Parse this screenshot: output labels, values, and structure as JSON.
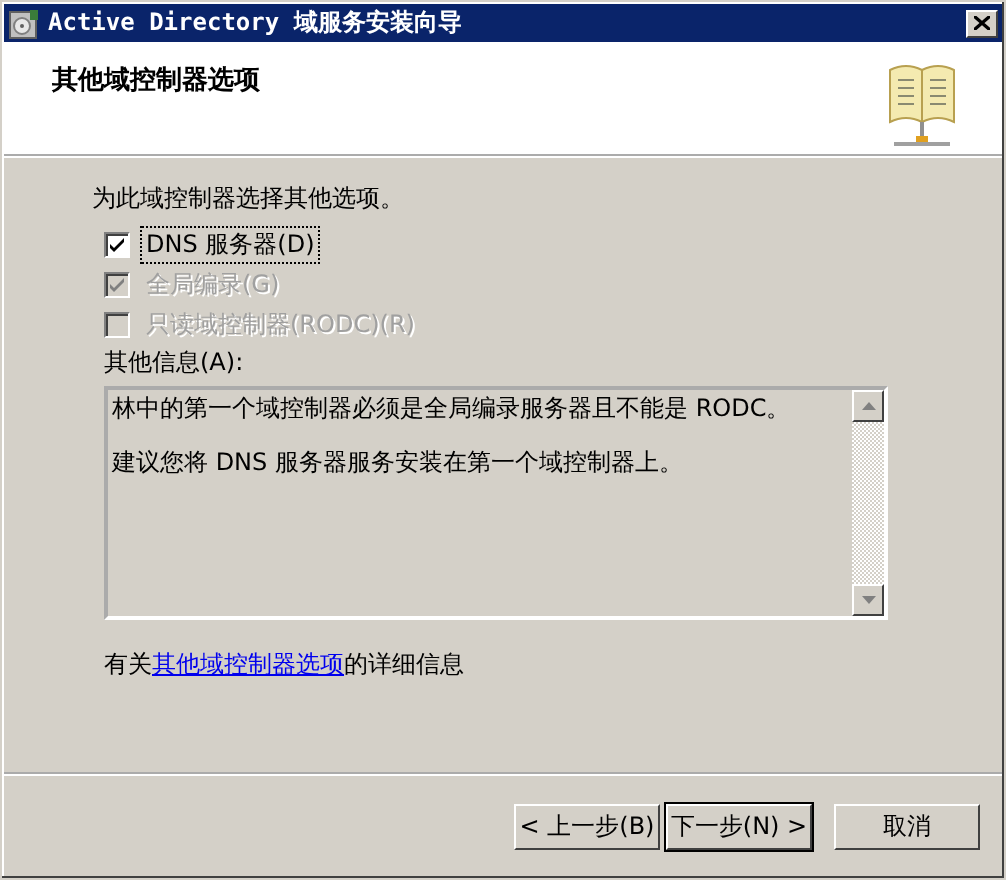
{
  "window": {
    "title": "Active Directory 域服务安装向导"
  },
  "header": {
    "title": "其他域控制器选项"
  },
  "prompt": "为此域控制器选择其他选项。",
  "options": [
    {
      "label": "DNS 服务器(D)",
      "checked": true,
      "disabled": false,
      "focused": true
    },
    {
      "label": "全局编录(G)",
      "checked": true,
      "disabled": true,
      "focused": false
    },
    {
      "label": "只读域控制器(RODC)(R)",
      "checked": false,
      "disabled": true,
      "focused": false
    }
  ],
  "info": {
    "label": "其他信息(A):",
    "paragraphs": [
      "林中的第一个域控制器必须是全局编录服务器且不能是 RODC。",
      "建议您将 DNS 服务器服务安装在第一个域控制器上。"
    ]
  },
  "more_info": {
    "prefix": "有关",
    "link": "其他域控制器选项",
    "suffix": "的详细信息"
  },
  "buttons": [
    {
      "label": "< 上一步(B)",
      "default": false
    },
    {
      "label": "下一步(N) >",
      "default": true
    },
    {
      "label": "取消",
      "default": false
    }
  ]
}
